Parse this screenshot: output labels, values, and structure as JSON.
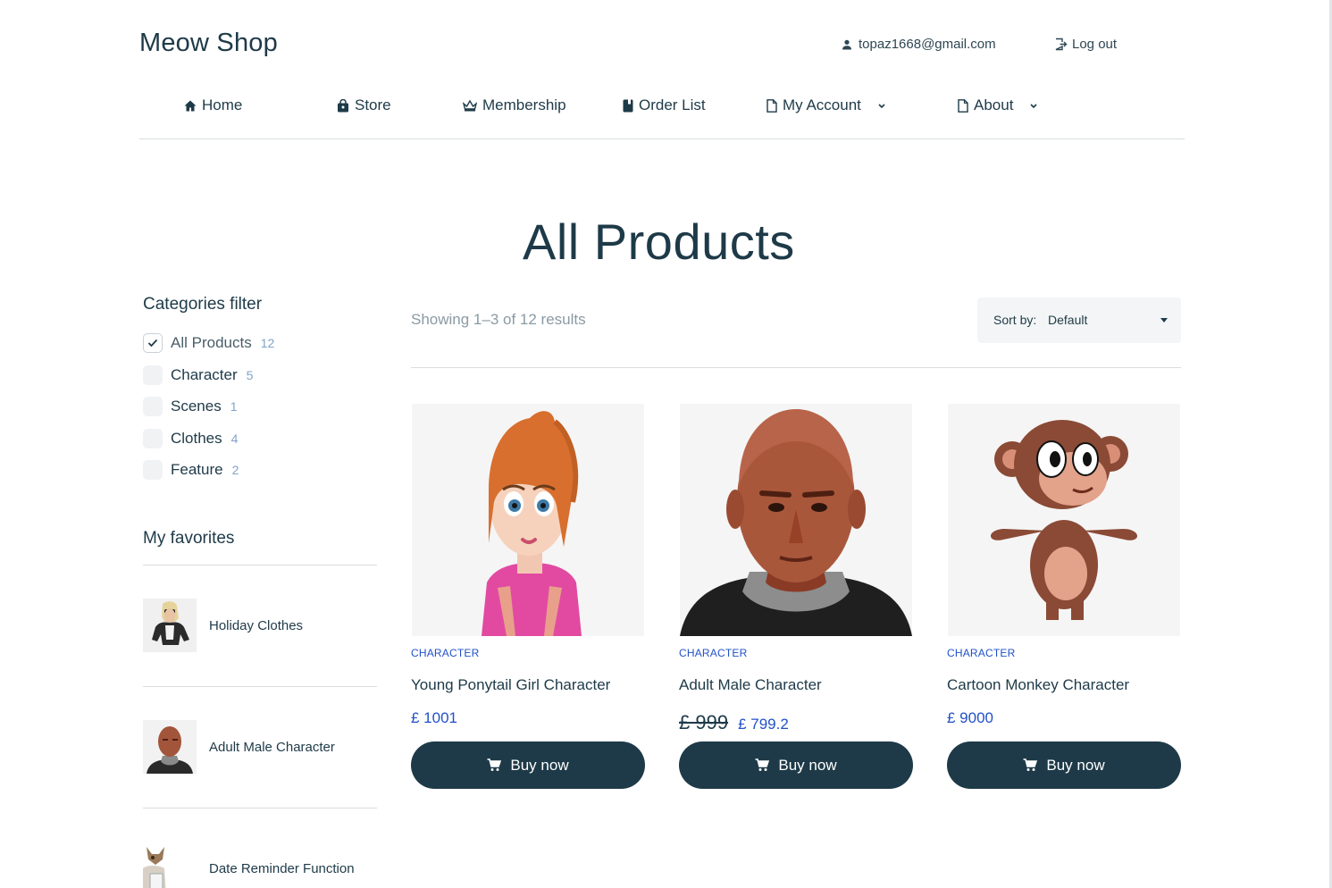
{
  "header": {
    "brand": "Meow Shop",
    "user_email": "topaz1668@gmail.com",
    "logout_label": "Log out"
  },
  "nav": {
    "items": [
      {
        "label": "Home",
        "icon": "home-icon"
      },
      {
        "label": "Store",
        "icon": "shopping-bag-icon"
      },
      {
        "label": "Membership",
        "icon": "crown-icon"
      },
      {
        "label": "Order List",
        "icon": "book-icon"
      },
      {
        "label": "My Account",
        "icon": "document-icon",
        "dropdown": true
      },
      {
        "label": "About",
        "icon": "document-icon",
        "dropdown": true
      }
    ]
  },
  "page": {
    "title": "All Products"
  },
  "sidebar": {
    "categories_heading": "Categories filter",
    "categories": [
      {
        "label": "All Products",
        "count": "12",
        "checked": true
      },
      {
        "label": "Character",
        "count": "5",
        "checked": false
      },
      {
        "label": "Scenes",
        "count": "1",
        "checked": false
      },
      {
        "label": "Clothes",
        "count": "4",
        "checked": false
      },
      {
        "label": "Feature",
        "count": "2",
        "checked": false
      }
    ],
    "favorites_heading": "My favorites",
    "favorites": [
      {
        "label": "Holiday Clothes"
      },
      {
        "label": "Adult Male Character"
      },
      {
        "label": "Date Reminder Function"
      }
    ]
  },
  "toolbar": {
    "results_text": "Showing 1–3 of 12 results",
    "sort_label": "Sort by:",
    "sort_value": "Default"
  },
  "products": [
    {
      "category": "CHARACTER",
      "title": "Young Ponytail Girl Character",
      "old_price": "",
      "price": "£ 1001",
      "button": "Buy now"
    },
    {
      "category": "CHARACTER",
      "title": "Adult Male Character",
      "old_price": "£ 999",
      "price": "£ 799.2",
      "button": "Buy now"
    },
    {
      "category": "CHARACTER",
      "title": "Cartoon Monkey Character",
      "old_price": "",
      "price": "£ 9000",
      "button": "Buy now"
    }
  ],
  "colors": {
    "primary": "#1e3a48",
    "accent_blue": "#2151c7",
    "count_blue": "#7fa3c9",
    "muted_text": "#8a9aa4"
  }
}
